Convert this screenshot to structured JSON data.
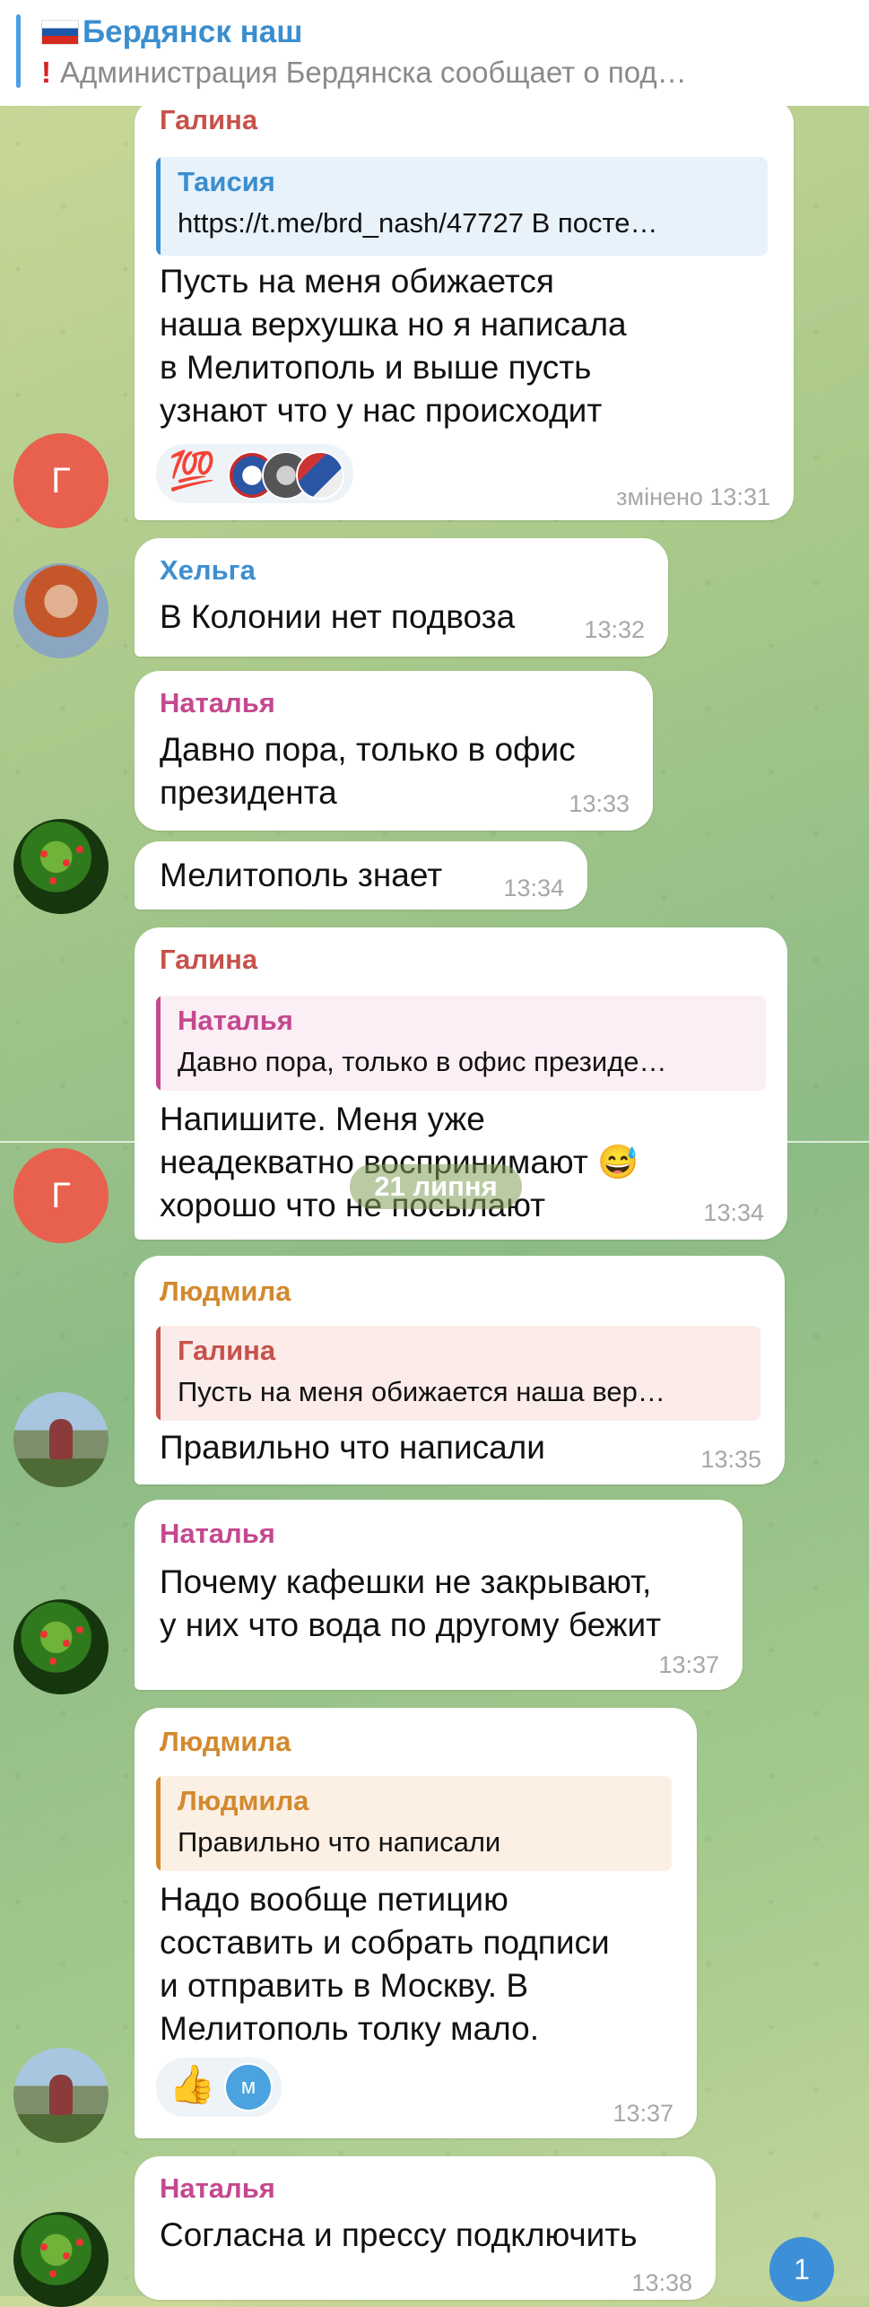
{
  "pinned": {
    "title": "Бердянск наш",
    "subtitle": "Администрация Бердянска сообщает о под…"
  },
  "messages": [
    {
      "name": "Галина",
      "name_color": "#c6524b",
      "quote": {
        "name": "Таисия",
        "text": "https://t.me/brd_nash/47727  В посте…",
        "color": "#3a8ecf"
      },
      "text": "Пусть на меня обижается\nнаша верхушка но я написала\nв Мелитополь и выше  пусть\nузнают что у нас происходит",
      "reactions": [
        "💯"
      ],
      "time": "змінено 13:31",
      "avatar": "Г"
    },
    {
      "name": "Хельга",
      "name_color": "#3d8fd1",
      "text": "В Колонии нет подвоза",
      "time": "13:32"
    },
    {
      "name": "Наталья",
      "name_color": "#c4488f",
      "text": "Давно пора, только в офис\nпрезидента",
      "time": "13:33"
    },
    {
      "text": "Мелитополь знает",
      "time": "13:34"
    },
    {
      "name": "Галина",
      "name_color": "#c6524b",
      "quote": {
        "name": "Наталья",
        "text": "Давно пора, только в офис президе…",
        "color": "#c4488f"
      },
      "text": "Напишите. Меня уже\nнеадекватно воспринимают 😅\nхорошо что не посылают",
      "time": "13:34",
      "avatar": "Г"
    },
    {
      "name": "Людмила",
      "name_color": "#d3892e",
      "quote": {
        "name": "Галина",
        "text": "Пусть на меня обижается наша вер…",
        "color": "#c6524b"
      },
      "text": "Правильно что написали",
      "time": "13:35"
    },
    {
      "name": "Наталья",
      "name_color": "#c4488f",
      "text": "Почему кафешки не закрывают,\nу них что вода по другому бежит",
      "time": "13:37"
    },
    {
      "name": "Людмила",
      "name_color": "#d3892e",
      "quote": {
        "name": "Людмила",
        "text": "Правильно что написали",
        "color": "#d3892e"
      },
      "text": "Надо вообще петицию\nсоставить и собрать подписи\nи отправить в Москву. В\nМелитополь толку мало.",
      "reactions": [
        "👍"
      ],
      "reaction_avatar": "м",
      "time": "13:37"
    },
    {
      "name": "Наталья",
      "name_color": "#c4488f",
      "text": "Согласна и прессу подключить",
      "time": "13:38"
    }
  ],
  "date_separator": "21 липня",
  "unread_badge": "1"
}
